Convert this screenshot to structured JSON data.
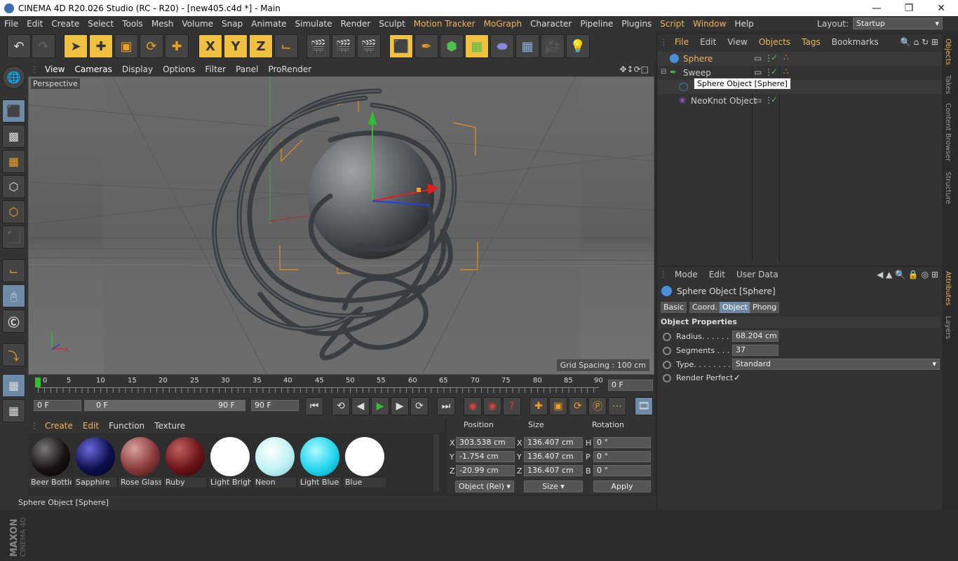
{
  "window": {
    "title": "CINEMA 4D R20.026 Studio (RC - R20) - [new405.c4d *] - Main"
  },
  "menu": [
    "File",
    "Edit",
    "Create",
    "Select",
    "Tools",
    "Mesh",
    "Volume",
    "Snap",
    "Animate",
    "Simulate",
    "Render",
    "Sculpt",
    "Motion Tracker",
    "MoGraph",
    "Character",
    "Pipeline",
    "Plugins",
    "Script",
    "Window",
    "Help"
  ],
  "layout": {
    "label": "Layout:",
    "value": "Startup"
  },
  "toolbar": {
    "x": "X",
    "y": "Y",
    "z": "Z"
  },
  "viewport": {
    "menu": [
      "View",
      "Cameras",
      "Display",
      "Options",
      "Filter",
      "Panel",
      "ProRender"
    ],
    "camera": "Perspective",
    "grid_spacing": "Grid Spacing : 100 cm"
  },
  "timeline": {
    "ticks": [
      "0",
      "5",
      "10",
      "15",
      "20",
      "25",
      "30",
      "35",
      "40",
      "45",
      "50",
      "55",
      "60",
      "65",
      "70",
      "75",
      "80",
      "85",
      "90"
    ],
    "end_field": "0 F",
    "start_frame": "0 F",
    "range_start": "0 F",
    "range_end": "90 F",
    "max_frame": "90 F"
  },
  "materials": {
    "menu": [
      "Create",
      "Edit",
      "Function",
      "Texture"
    ],
    "items": [
      {
        "name": "Beer Bottle",
        "color": "#1a1212"
      },
      {
        "name": "Sapphire",
        "color": "#0d0f4a"
      },
      {
        "name": "Rose Glass",
        "color": "#8a3a3a"
      },
      {
        "name": "Ruby",
        "color": "#6a1418"
      },
      {
        "name": "Light Brigh",
        "color": "#ffffff"
      },
      {
        "name": "Neon",
        "color": "#bff2f5"
      },
      {
        "name": "Light Blue",
        "color": "#22d6ee"
      },
      {
        "name": "Blue",
        "color": "#ffffff"
      }
    ]
  },
  "coords": {
    "headers": [
      "Position",
      "Size",
      "Rotation"
    ],
    "rows": [
      {
        "axis": "X",
        "pos": "303.538 cm",
        "saxis": "X",
        "size": "136.407 cm",
        "raxis": "H",
        "rot": "0 °"
      },
      {
        "axis": "Y",
        "pos": "-1.754 cm",
        "saxis": "Y",
        "size": "136.407 cm",
        "raxis": "P",
        "rot": "0 °"
      },
      {
        "axis": "Z",
        "pos": "-20.99 cm",
        "saxis": "Z",
        "size": "136.407 cm",
        "raxis": "B",
        "rot": "0 °"
      }
    ],
    "mode": "Object (Rel)",
    "size_mode": "Size",
    "apply": "Apply"
  },
  "status": "Sphere Object [Sphere]",
  "objects": {
    "menu": [
      "File",
      "Edit",
      "View",
      "Objects",
      "Tags",
      "Bookmarks"
    ],
    "items": [
      {
        "name": "Sphere"
      },
      {
        "name": "Sweep"
      },
      {
        "name": ""
      },
      {
        "name": "NeoKnot Object"
      }
    ],
    "tooltip": "Sphere Object [Sphere]"
  },
  "attributes": {
    "menu": [
      "Mode",
      "Edit",
      "User Data"
    ],
    "title": "Sphere Object [Sphere]",
    "tabs": [
      "Basic",
      "Coord.",
      "Object",
      "Phong"
    ],
    "section": "Object Properties",
    "props": [
      {
        "label": "Radius. . . . . . .",
        "value": "68.204 cm"
      },
      {
        "label": "Segments . . . .",
        "value": "37"
      },
      {
        "label": "Type. . . . . . . . .",
        "value": "Standard"
      },
      {
        "label": "Render Perfect",
        "value": "✓"
      }
    ]
  },
  "side_tabs": [
    "Objects",
    "Takes",
    "Content Browser",
    "Structure",
    "Attributes",
    "Layers"
  ]
}
